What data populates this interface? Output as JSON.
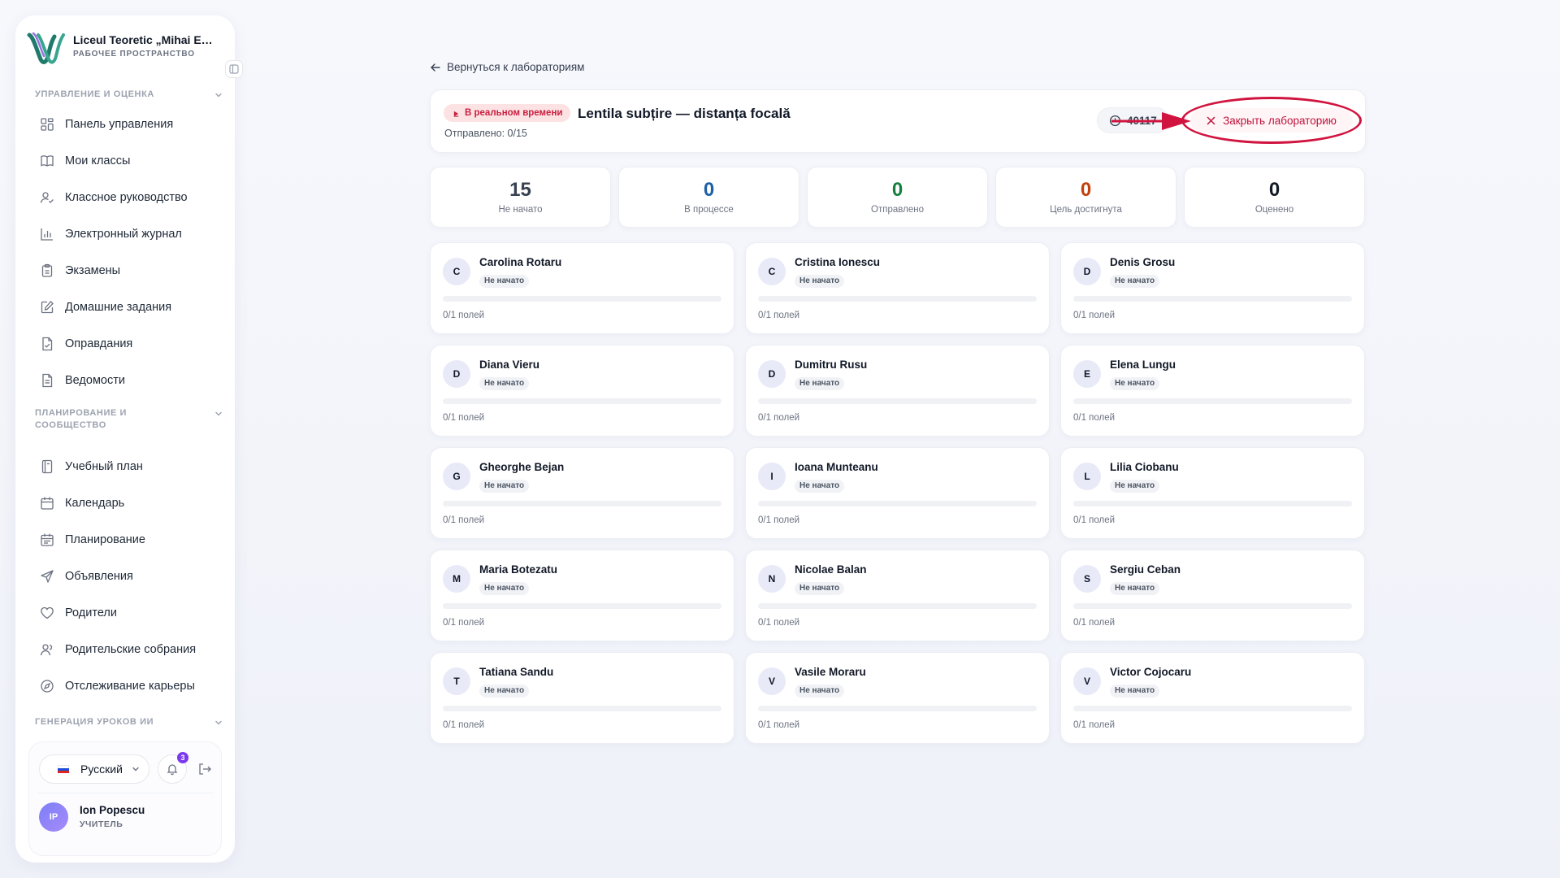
{
  "sidebar": {
    "brand": {
      "name": "Liceul Teoretic „Mihai Eminescu”",
      "subtitle": "РАБОЧЕЕ ПРОСТРАНСТВО"
    },
    "sections": [
      {
        "title": "УПРАВЛЕНИЕ И ОЦЕНКА"
      },
      {
        "title": "ПЛАНИРОВАНИЕ И СООБЩЕСТВО"
      },
      {
        "title": "ГЕНЕРАЦИЯ УРОКОВ ИИ"
      }
    ],
    "items": [
      {
        "label": "Панель управления",
        "icon": "grid-icon"
      },
      {
        "label": "Мои классы",
        "icon": "book-open-icon"
      },
      {
        "label": "Классное руководство",
        "icon": "user-check-icon"
      },
      {
        "label": "Электронный журнал",
        "icon": "bar-chart-icon"
      },
      {
        "label": "Экзамены",
        "icon": "clipboard-icon"
      },
      {
        "label": "Домашние задания",
        "icon": "edit-icon"
      },
      {
        "label": "Оправдания",
        "icon": "file-check-icon"
      },
      {
        "label": "Ведомости",
        "icon": "file-text-icon"
      },
      {
        "label": "Учебный план",
        "icon": "notebook-icon"
      },
      {
        "label": "Календарь",
        "icon": "calendar-icon"
      },
      {
        "label": "Планирование",
        "icon": "calendar-lines-icon"
      },
      {
        "label": "Объявления",
        "icon": "send-icon"
      },
      {
        "label": "Родители",
        "icon": "heart-icon"
      },
      {
        "label": "Родительские собрания",
        "icon": "users-icon"
      },
      {
        "label": "Отслеживание карьеры",
        "icon": "compass-icon"
      }
    ],
    "footer": {
      "language": "Русский",
      "notifications_count": "3",
      "user": {
        "initials": "IP",
        "name": "Ion Popescu",
        "role": "УЧИТЕЛЬ"
      }
    }
  },
  "main": {
    "back_label": "Вернуться к лабораториям",
    "header": {
      "live_label": "В реальном времени",
      "title": "Lentila subțire — distanța focală",
      "submitted": "Отправлено: 0/15",
      "timer": "40117",
      "close_label": "Закрыть лабораторию"
    },
    "stats": [
      {
        "value": "15",
        "label": "Не начато",
        "color": "#374151"
      },
      {
        "value": "0",
        "label": "В процессе",
        "color": "#1d5fa8"
      },
      {
        "value": "0",
        "label": "Отправлено",
        "color": "#15803d"
      },
      {
        "value": "0",
        "label": "Цель достигнута",
        "color": "#c2410c"
      },
      {
        "value": "0",
        "label": "Оценено",
        "color": "#111827"
      }
    ],
    "students": [
      {
        "initial": "C",
        "name": "Carolina Rotaru",
        "status": "Не начато",
        "fields": "0/1 полей",
        "progress": 0
      },
      {
        "initial": "C",
        "name": "Cristina Ionescu",
        "status": "Не начато",
        "fields": "0/1 полей",
        "progress": 0
      },
      {
        "initial": "D",
        "name": "Denis Grosu",
        "status": "Не начато",
        "fields": "0/1 полей",
        "progress": 0
      },
      {
        "initial": "D",
        "name": "Diana Vieru",
        "status": "Не начато",
        "fields": "0/1 полей",
        "progress": 0
      },
      {
        "initial": "D",
        "name": "Dumitru Rusu",
        "status": "Не начато",
        "fields": "0/1 полей",
        "progress": 0
      },
      {
        "initial": "E",
        "name": "Elena Lungu",
        "status": "Не начато",
        "fields": "0/1 полей",
        "progress": 0
      },
      {
        "initial": "G",
        "name": "Gheorghe Bejan",
        "status": "Не начато",
        "fields": "0/1 полей",
        "progress": 0
      },
      {
        "initial": "I",
        "name": "Ioana Munteanu",
        "status": "Не начато",
        "fields": "0/1 полей",
        "progress": 0
      },
      {
        "initial": "L",
        "name": "Lilia Ciobanu",
        "status": "Не начато",
        "fields": "0/1 полей",
        "progress": 0
      },
      {
        "initial": "M",
        "name": "Maria Botezatu",
        "status": "Не начато",
        "fields": "0/1 полей",
        "progress": 0
      },
      {
        "initial": "N",
        "name": "Nicolae Balan",
        "status": "Не начато",
        "fields": "0/1 полей",
        "progress": 0
      },
      {
        "initial": "S",
        "name": "Sergiu Ceban",
        "status": "Не начато",
        "fields": "0/1 полей",
        "progress": 0
      },
      {
        "initial": "T",
        "name": "Tatiana Sandu",
        "status": "Не начато",
        "fields": "0/1 полей",
        "progress": 0
      },
      {
        "initial": "V",
        "name": "Vasile Moraru",
        "status": "Не начато",
        "fields": "0/1 полей",
        "progress": 0
      },
      {
        "initial": "V",
        "name": "Victor Cojocaru",
        "status": "Не начато",
        "fields": "0/1 полей",
        "progress": 0
      }
    ]
  }
}
